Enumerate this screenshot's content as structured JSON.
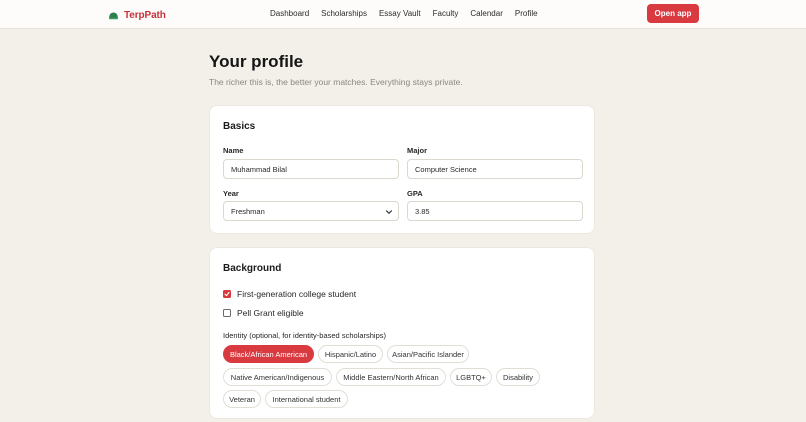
{
  "brand": {
    "name": "TerpPath",
    "logo_color": "#2e7d4f"
  },
  "nav": {
    "items": [
      "Dashboard",
      "Scholarships",
      "Essay Vault",
      "Faculty",
      "Calendar",
      "Profile"
    ],
    "open_app_label": "Open app"
  },
  "page": {
    "title": "Your profile",
    "subtitle": "The richer this is, the better your matches. Everything stays private."
  },
  "basics": {
    "title": "Basics",
    "name_label": "Name",
    "name_value": "Muhammad Bilal",
    "major_label": "Major",
    "major_value": "Computer Science",
    "year_label": "Year",
    "year_value": "Freshman",
    "gpa_label": "GPA",
    "gpa_value": "3.85"
  },
  "background": {
    "title": "Background",
    "checks": [
      {
        "label": "First-generation college student",
        "checked": true
      },
      {
        "label": "Pell Grant eligible",
        "checked": false
      }
    ],
    "identity_label": "Identity (optional, for identity-based scholarships)",
    "identities": [
      {
        "label": "Black/African American",
        "selected": true
      },
      {
        "label": "Hispanic/Latino",
        "selected": false
      },
      {
        "label": "Asian/Pacific Islander",
        "selected": false
      },
      {
        "label": "Native American/Indigenous",
        "selected": false
      },
      {
        "label": "Middle Eastern/North African",
        "selected": false
      },
      {
        "label": "LGBTQ+",
        "selected": false
      },
      {
        "label": "Disability",
        "selected": false
      },
      {
        "label": "Veteran",
        "selected": false
      },
      {
        "label": "International student",
        "selected": false
      }
    ]
  },
  "colors": {
    "accent": "#d93a40",
    "page_bg": "#f3f0e9",
    "card_bg": "#ffffff"
  }
}
